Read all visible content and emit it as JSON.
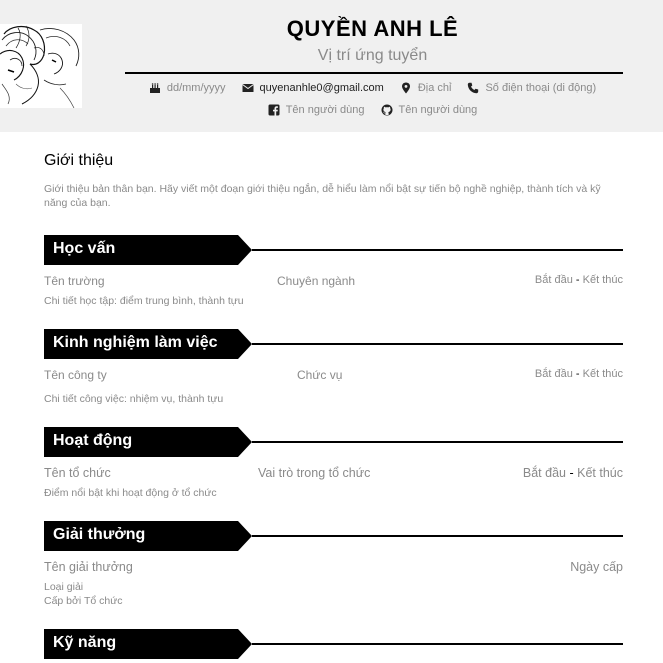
{
  "header": {
    "name": "QUYỀN ANH LÊ",
    "position": "Vị trí ứng tuyển",
    "contacts_row1": [
      {
        "icon": "birthday-cake-icon",
        "text": "dd/mm/yyyy"
      },
      {
        "icon": "email-icon",
        "text": "quyenanhle0@gmail.com"
      },
      {
        "icon": "location-pin-icon",
        "text": "Địa chỉ"
      },
      {
        "icon": "phone-icon",
        "text": "Số điện thoại (di động)"
      }
    ],
    "contacts_row2": [
      {
        "icon": "facebook-icon",
        "text": "Tên người dùng"
      },
      {
        "icon": "github-icon",
        "text": "Tên người dùng"
      }
    ]
  },
  "intro": {
    "title": "Giới thiệu",
    "text": "Giới thiệu bản thân bạn. Hãy viết một đoạn giới thiệu ngắn, dễ hiểu làm nổi bật sự tiến bộ nghề nghiệp, thành tích và kỹ năng của bạn."
  },
  "education": {
    "title": "Học vấn",
    "school": "Tên trường",
    "major": "Chuyên ngành",
    "start": "Bắt đầu",
    "dash": "-",
    "end": "Kết thúc",
    "detail": "Chi tiết học tập: điểm trung bình, thành tựu"
  },
  "experience": {
    "title": "Kinh nghiệm làm việc",
    "company": "Tên công ty",
    "role": "Chức vụ",
    "start": "Bắt đầu",
    "dash": "-",
    "end": "Kết thúc",
    "detail": "Chi tiết công việc: nhiệm vụ, thành tựu"
  },
  "activities": {
    "title": "Hoạt động",
    "org": "Tên tổ chức",
    "role": "Vai trò trong tổ chức",
    "start": "Bắt đầu",
    "dash": "-",
    "end": "Kết thúc",
    "detail": "Điểm nổi bật khi hoạt động ở tổ chức"
  },
  "awards": {
    "title": "Giải thưởng",
    "name": "Tên giải thưởng",
    "date": "Ngày cấp",
    "type": "Loại giải",
    "issuer": "Cấp bởi Tổ chức"
  },
  "skills": {
    "title": "Kỹ năng"
  }
}
